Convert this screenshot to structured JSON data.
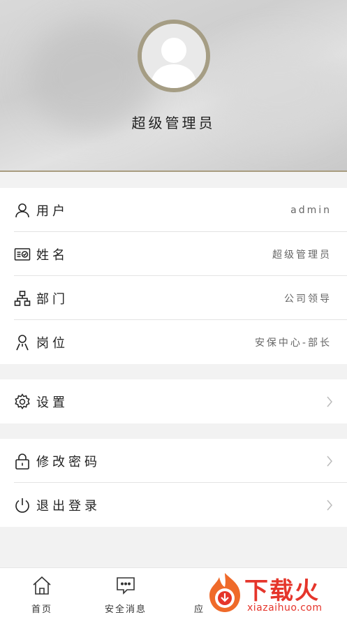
{
  "profile": {
    "name": "超级管理员",
    "avatar_icon": "default-user-avatar"
  },
  "info": [
    {
      "icon": "user-icon",
      "label": "用户",
      "value": "admin"
    },
    {
      "icon": "id-card-icon",
      "label": "姓名",
      "value": "超级管理员"
    },
    {
      "icon": "org-chart-icon",
      "label": "部门",
      "value": "公司领导"
    },
    {
      "icon": "person-icon",
      "label": "岗位",
      "value": "安保中心-部长"
    }
  ],
  "settings": {
    "icon": "gear-icon",
    "label": "设置"
  },
  "account": [
    {
      "icon": "lock-icon",
      "label": "修改密码"
    },
    {
      "icon": "power-icon",
      "label": "退出登录"
    }
  ],
  "tabbar": [
    {
      "icon": "home-icon",
      "label": "首页"
    },
    {
      "icon": "chat-bubble-icon",
      "label": "安全消息"
    },
    {
      "icon": "app-icon",
      "label": "应"
    }
  ],
  "watermark": {
    "text": "下载火",
    "sub": "xiazaihuo.com"
  },
  "colors": {
    "accent_border": "#a89c7f",
    "watermark_red": "#e5352b"
  }
}
